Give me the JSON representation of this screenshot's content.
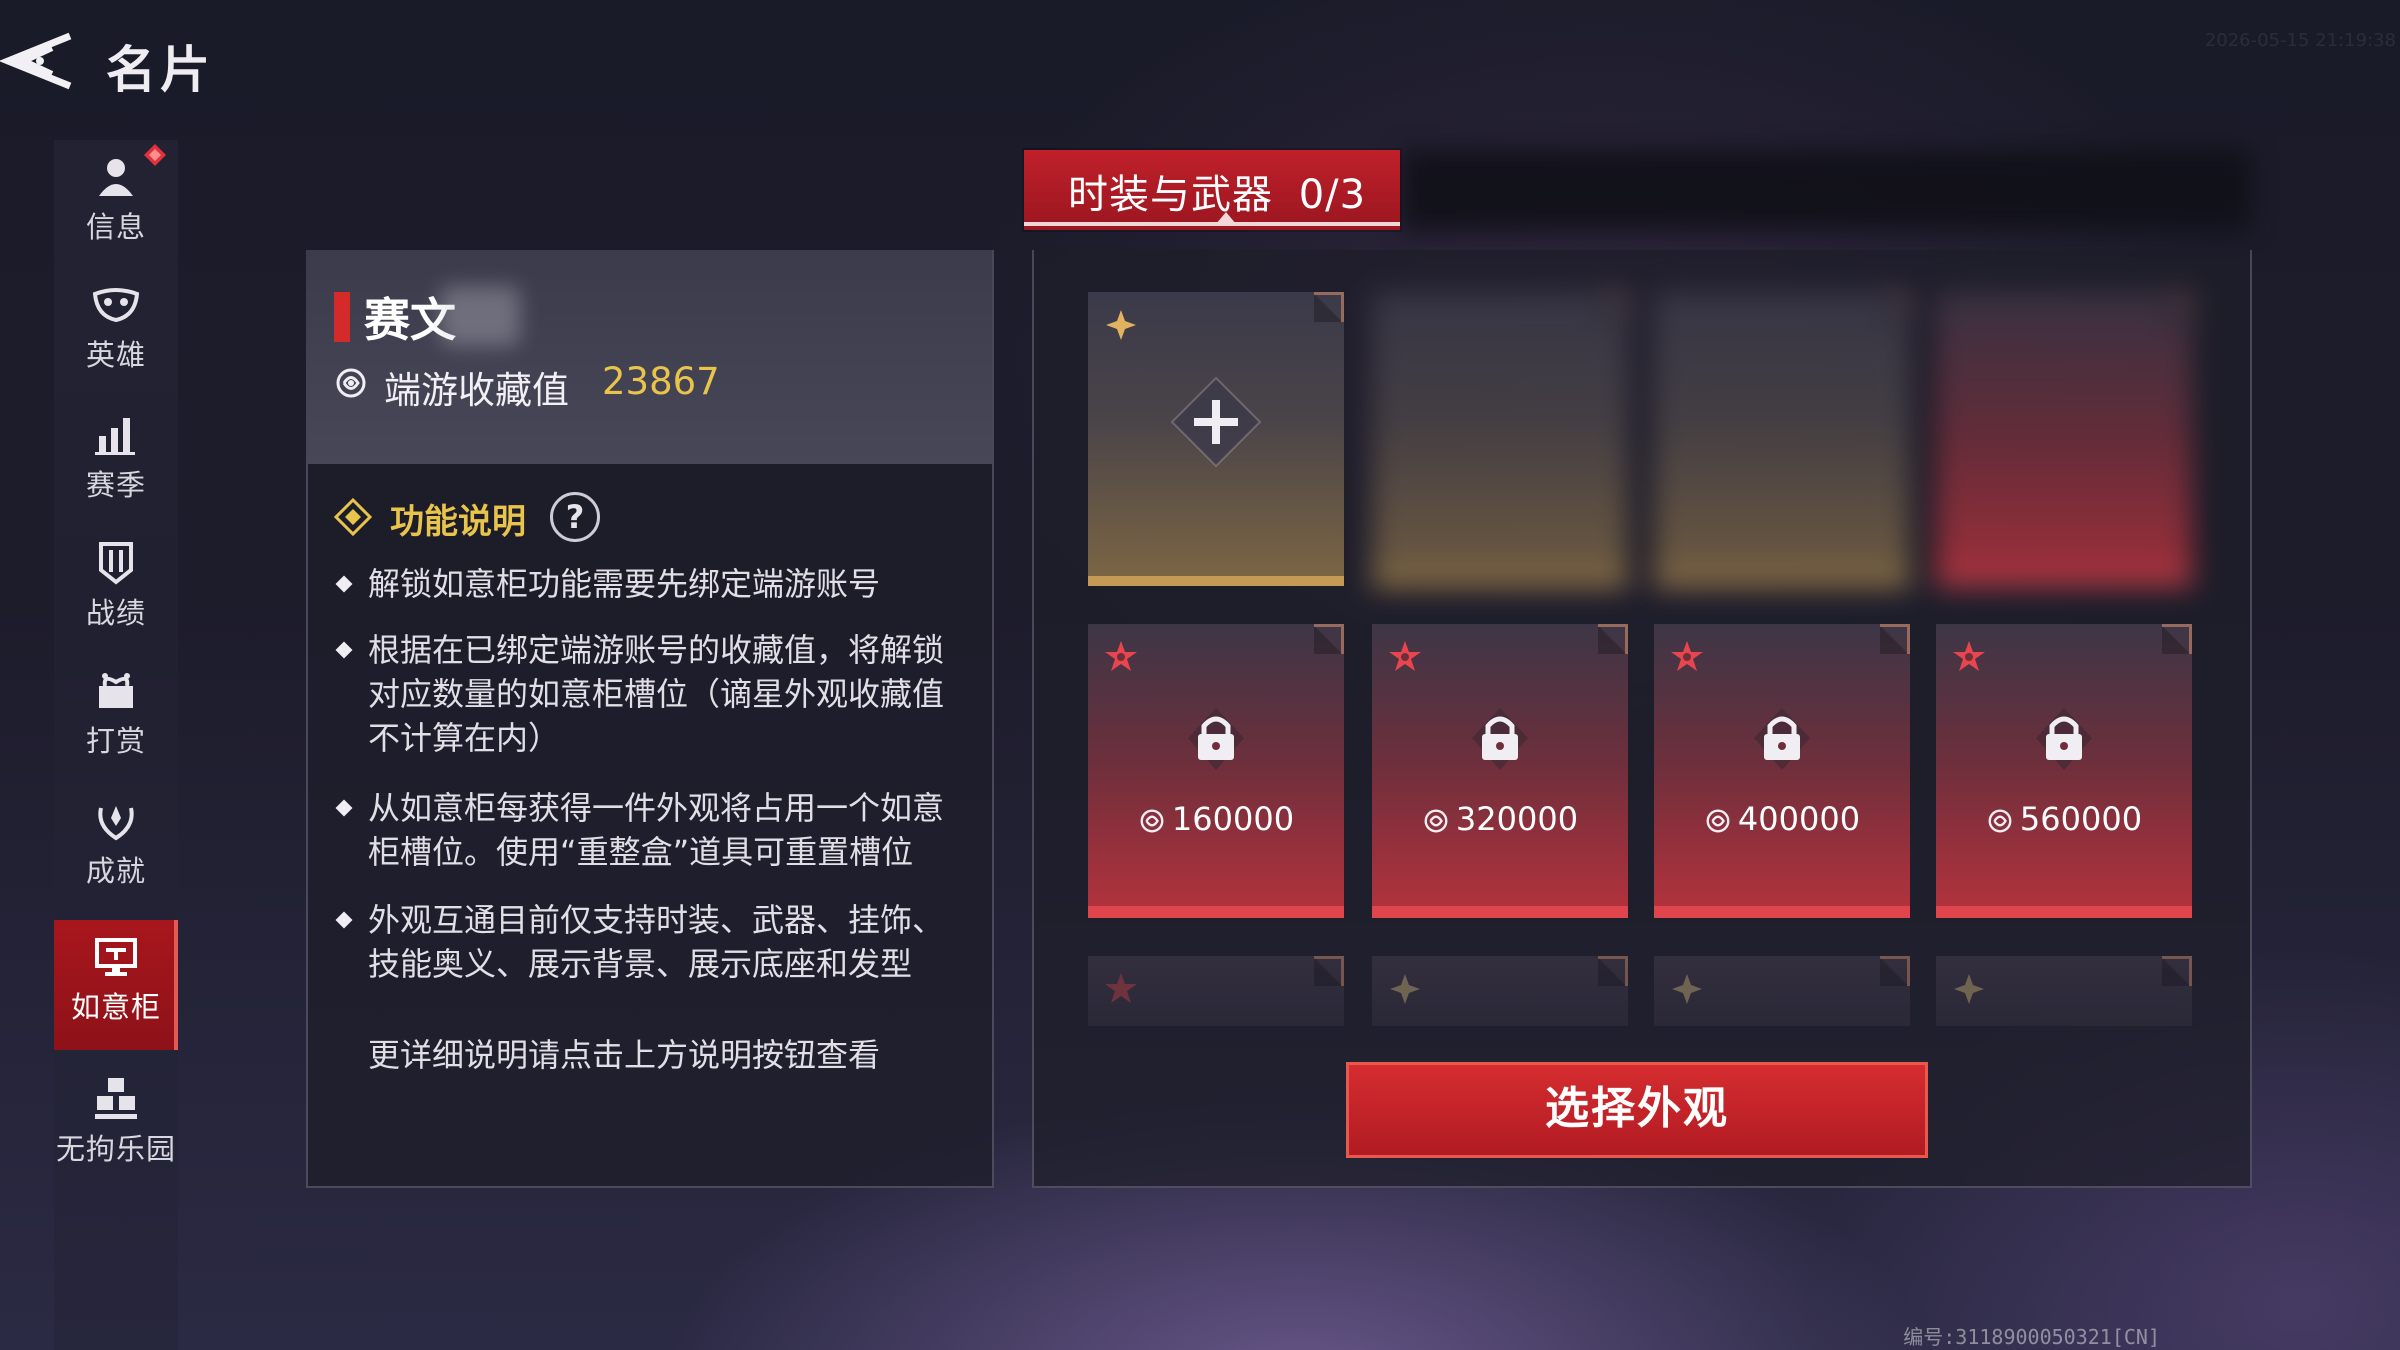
{
  "header": {
    "title": "名片",
    "timestamp": "2026-05-15 21:19:38"
  },
  "sidebar": {
    "items": [
      {
        "label": "信息",
        "icon": "person-icon",
        "active": false,
        "badge": true
      },
      {
        "label": "英雄",
        "icon": "mask-icon",
        "active": false
      },
      {
        "label": "赛季",
        "icon": "bar-chart-icon",
        "active": false
      },
      {
        "label": "战绩",
        "icon": "shield-icon",
        "active": false
      },
      {
        "label": "打赏",
        "icon": "gift-icon",
        "active": false
      },
      {
        "label": "成就",
        "icon": "laurel-icon",
        "active": false
      },
      {
        "label": "如意柜",
        "icon": "display-icon",
        "active": true
      },
      {
        "label": "无拘乐园",
        "icon": "blocks-icon",
        "active": false
      }
    ]
  },
  "info": {
    "player_name": "赛文",
    "collect_label": "端游收藏值",
    "collect_value": "23867",
    "func_title": "功能说明",
    "help_symbol": "?",
    "descriptions": [
      "解锁如意柜功能需要先绑定端游账号",
      "根据在已绑定端游账号的收藏值，将解锁对应数量的如意柜槽位（谪星外观收藏值不计算在内）",
      "从如意柜每获得一件外观将占用一个如意柜槽位。使用“重整盒”道具可重置槽位",
      "外观互通目前仅支持时装、武器、挂饰、技能奥义、展示背景、展示底座和发型"
    ],
    "more": "更详细说明请点击上方说明按钮查看"
  },
  "tabs": {
    "active_label": "时装与武器",
    "count": "0/3"
  },
  "slots": {
    "locked": [
      {
        "cost": "160000"
      },
      {
        "cost": "320000"
      },
      {
        "cost": "400000"
      },
      {
        "cost": "560000"
      }
    ]
  },
  "select_button": "选择外观",
  "uid": "编号:3118900050321[CN]",
  "colors": {
    "accent_red": "#c0202a",
    "gold": "#e8c44c",
    "slot_gold": "#c49a55",
    "slot_red": "#e0454e"
  }
}
